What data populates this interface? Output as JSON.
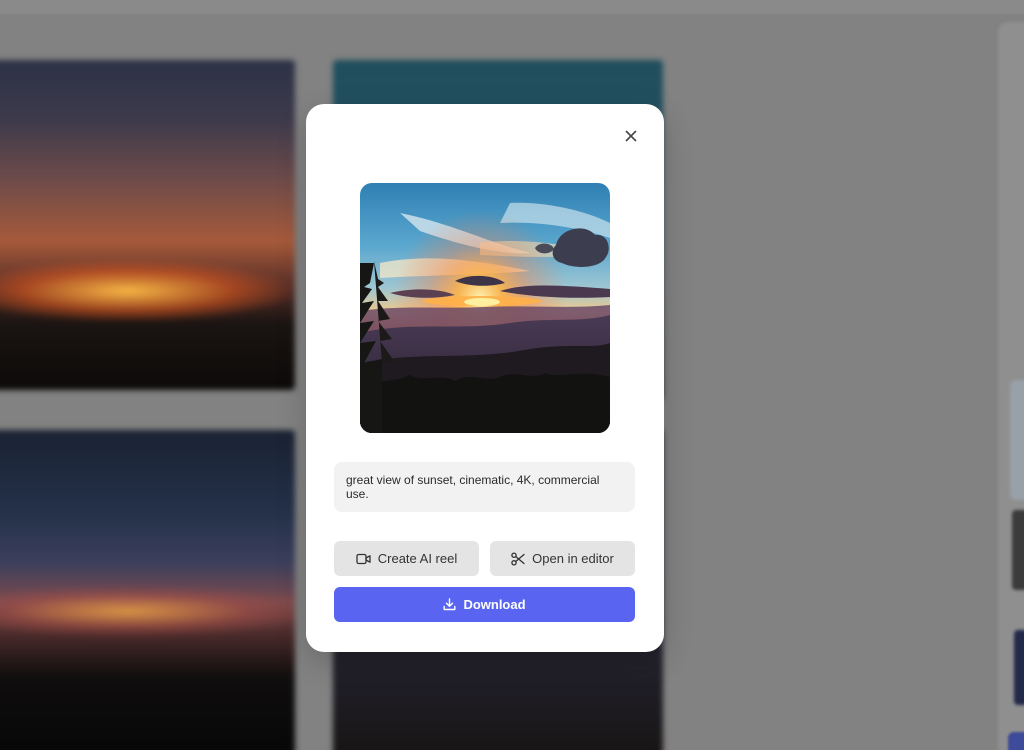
{
  "modal": {
    "prompt_text": "great view of sunset, cinematic, 4K, commercial use.",
    "buttons": {
      "create_reel_label": "Create AI reel",
      "open_editor_label": "Open in editor",
      "download_label": "Download"
    },
    "icons": {
      "close": "close-icon",
      "create_reel": "video-camera-icon",
      "open_editor": "scissors-icon",
      "download": "download-icon"
    }
  },
  "colors": {
    "primary_button": "#5965f0",
    "secondary_button": "#e4e4e4",
    "prompt_box": "#f2f2f2",
    "backdrop": "#828282"
  }
}
